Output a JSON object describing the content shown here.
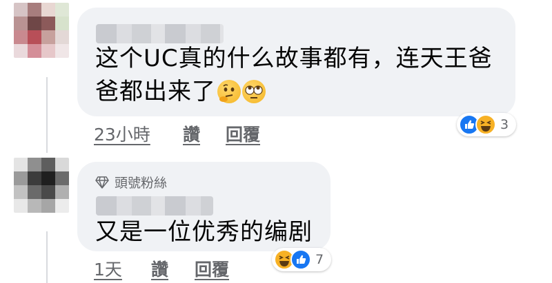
{
  "comments": [
    {
      "text_line1": "这个UC真的什么故事都有，连天王爸",
      "text_line2": "爸都出来了",
      "emojis": [
        "thinking-face",
        "face-with-rolling-eyes"
      ],
      "reaction_icons": [
        "like",
        "haha"
      ],
      "reaction_count": "3",
      "actions": {
        "time": "23小時",
        "like": "讚",
        "reply": "回覆"
      }
    },
    {
      "badge": "頭號粉絲",
      "text_line1": "又是一位优秀的编剧",
      "reaction_icons": [
        "haha",
        "like"
      ],
      "reaction_count": "7",
      "actions": {
        "time": "1天",
        "like": "讚",
        "reply": "回覆"
      }
    }
  ],
  "colors": {
    "bubble": "#f0f2f5",
    "like_blue": "#1877f2",
    "haha_yellow": "#f7b125",
    "secondary_text": "#65676b"
  }
}
